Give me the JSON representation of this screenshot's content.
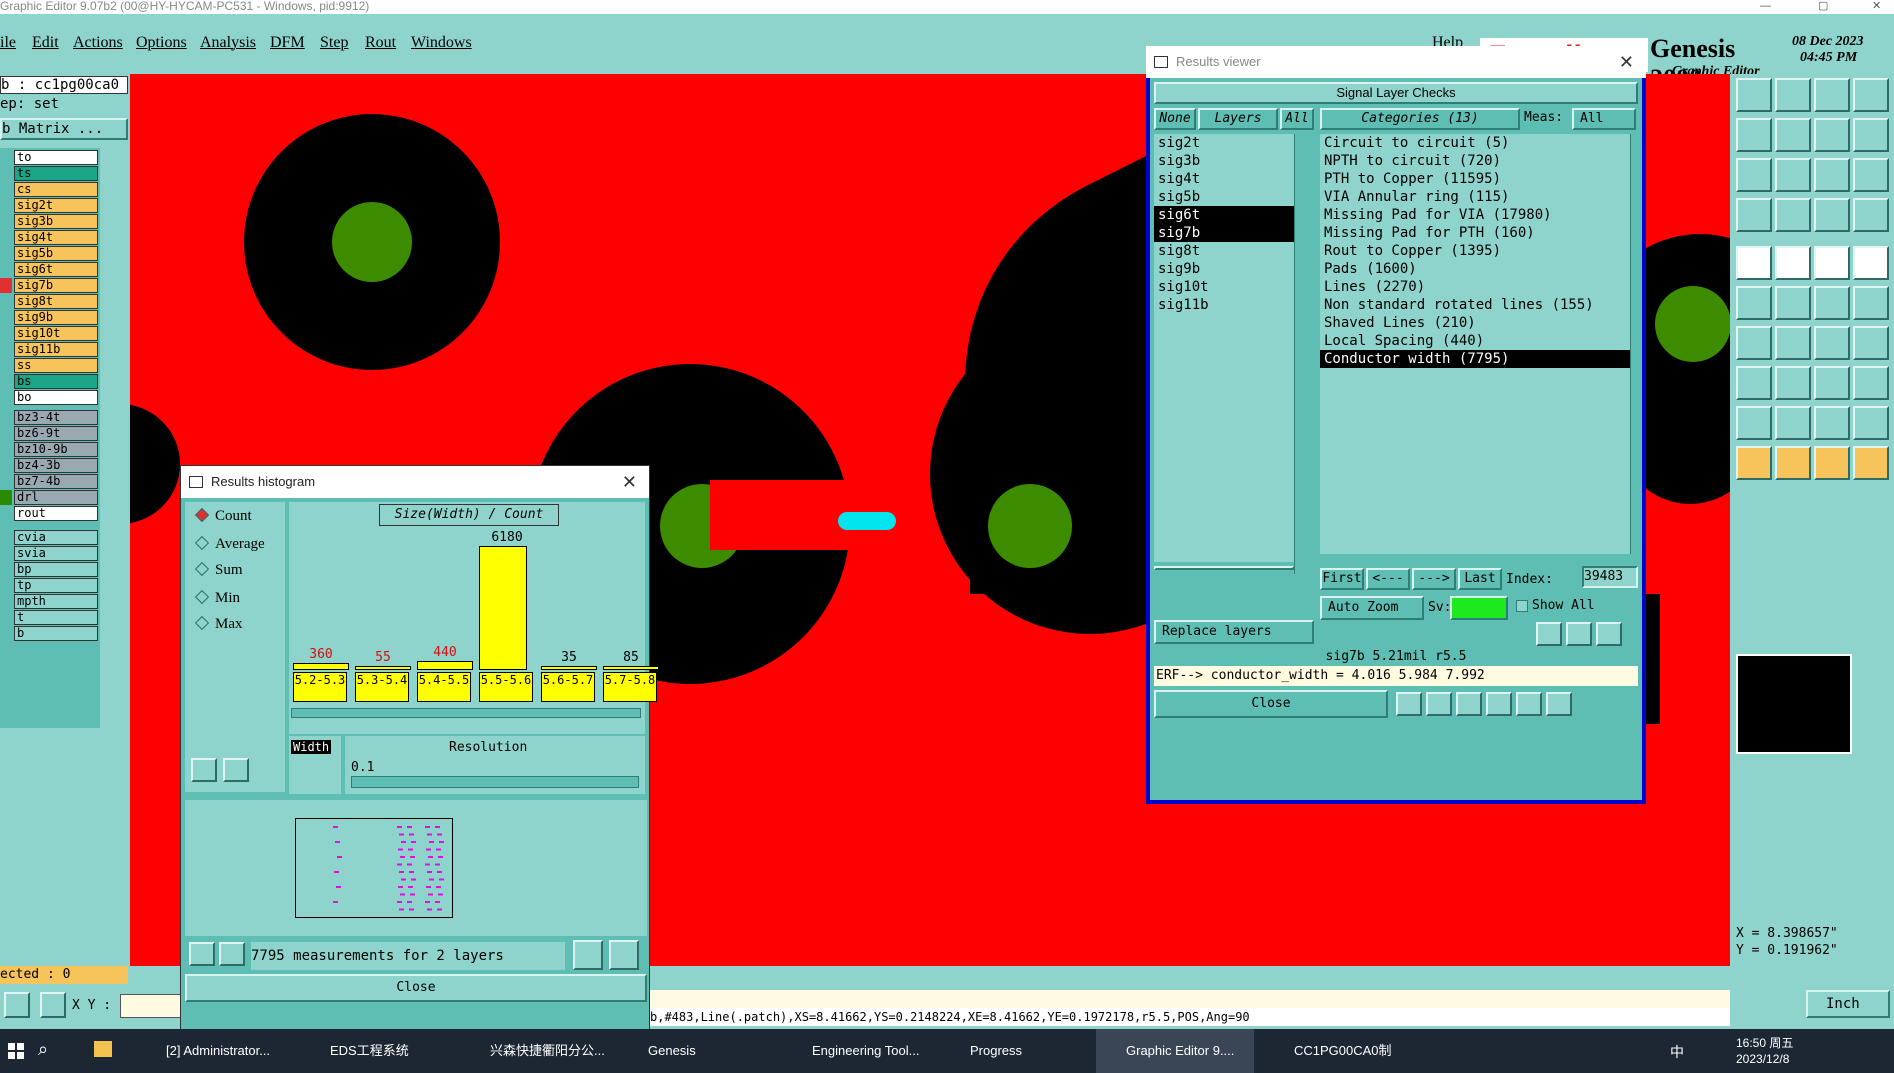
{
  "window": {
    "title": "Graphic Editor 9.07b2 (00@HY-HYCAM-PC531 - Windows, pid:9912)"
  },
  "menu": {
    "items": [
      "ile",
      "Edit",
      "Actions",
      "Options",
      "Analysis",
      "DFM",
      "Step",
      "Rout",
      "Windows"
    ],
    "help": "Help"
  },
  "brand": {
    "logo": "Frontline",
    "product": "Genesis 2000",
    "subtitle": "Graphic Editor",
    "date": "08 Dec 2023",
    "time": "04:45 PM"
  },
  "job": {
    "job_line": "b : cc1pg00ca0",
    "step_line": "ep: set",
    "matrix_button": "b Matrix ..."
  },
  "layers_panel": {
    "items": [
      "to",
      "ts",
      "cs",
      "sig2t",
      "sig3b",
      "sig4t",
      "sig5b",
      "sig6t",
      "sig7b",
      "sig8t",
      "sig9b",
      "sig10t",
      "sig11b",
      "ss",
      "bs",
      "bo"
    ],
    "items2": [
      "bz3-4t",
      "bz6-9t",
      "bz10-9b",
      "bz4-3b",
      "bz7-4b",
      "drl",
      "rout"
    ],
    "items3": [
      "cvia",
      "svia",
      "bp",
      "tp",
      "mpth",
      "t",
      "b"
    ],
    "selected_line": "ected : 0"
  },
  "results_viewer": {
    "title": "Results viewer",
    "header": "Signal Layer Checks",
    "buttons": {
      "none": "None",
      "layers": "Layers",
      "all": "All"
    },
    "categories_label": "Categories (13)",
    "meas_label": "Meas:",
    "meas_value": "All",
    "layers": [
      "sig2t",
      "sig3b",
      "sig4t",
      "sig5b",
      "sig6t",
      "sig7b",
      "sig8t",
      "sig9b",
      "sig10t",
      "sig11b"
    ],
    "categories": [
      "Circuit to circuit (5)",
      "NPTH to circuit (720)",
      "PTH to Copper (11595)",
      "VIA Annular ring (115)",
      "Missing Pad for VIA (17980)",
      "Missing Pad for PTH (160)",
      "Rout to Copper (1395)",
      "Pads (1600)",
      "Lines (2270)",
      "Non standard rotated lines (155)",
      "Shaved Lines (210)",
      "Local Spacing (440)",
      "Conductor width (7795)"
    ],
    "nav": {
      "first": "First",
      "prev": "<---",
      "next": "--->",
      "last": "Last",
      "index_label": "Index:",
      "index_value": "39483"
    },
    "auto_zoom": "Auto Zoom",
    "sv_label": "Sv:",
    "show_all": "Show All",
    "replace_layers": "Replace layers",
    "info_line": "sig7b 5.21mil  r5.5",
    "erf_line": "ERF--> conductor_width = 4.016 5.984 7.992",
    "close": "Close"
  },
  "histogram": {
    "title": "Results histogram",
    "chart_title": "Size(Width) / Count",
    "options": [
      "Count",
      "Average",
      "Sum",
      "Min",
      "Max"
    ],
    "width_label": "Width",
    "resolution_label": "Resolution",
    "resolution_value": "0.1",
    "summary": "7795 measurements for 2 layers",
    "close": "Close"
  },
  "chart_data": {
    "type": "bar",
    "title": "Size(Width) / Count",
    "categories": [
      "5.2-5.3",
      "5.3-5.4",
      "5.4-5.5",
      "5.5-5.6",
      "5.6-5.7",
      "5.7-5.8"
    ],
    "values": [
      360,
      55,
      440,
      6180,
      35,
      85
    ],
    "ylim": [
      0,
      6180
    ]
  },
  "coords": {
    "x": "X = 8.398657\"",
    "y": "Y = 0.191962\""
  },
  "bottom": {
    "xy_label": "X Y :",
    "units": "Inch",
    "status": "b,#483,Line(.patch),XS=8.41662,YS=0.2148224,XE=8.41662,YE=0.1972178,r5.5,POS,Ang=90"
  },
  "taskbar": {
    "tasks": [
      "[2] Administrator...",
      "EDS工程系统",
      "兴森快捷衢阳分公...",
      "Genesis",
      "Engineering Tool...",
      "Progress",
      "Graphic Editor 9....",
      "CC1PG00CA0制作..."
    ],
    "ime": "中",
    "time": "16:50 周五",
    "date": "2023/12/8"
  }
}
